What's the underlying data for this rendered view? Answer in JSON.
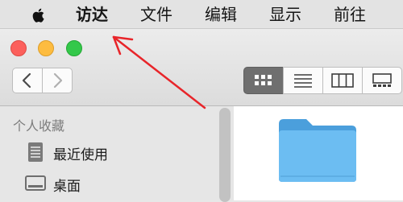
{
  "menubar": {
    "apple_icon": "apple-logo-icon",
    "items": [
      {
        "label": "访达",
        "bold": true
      },
      {
        "label": "文件"
      },
      {
        "label": "编辑"
      },
      {
        "label": "显示"
      },
      {
        "label": "前往"
      }
    ]
  },
  "window": {
    "traffic_lights": {
      "close": "#fc605c",
      "minimize": "#fdbc40",
      "maximize": "#34c84a"
    },
    "toolbar": {
      "back_icon": "chevron-left-icon",
      "forward_icon": "chevron-right-icon",
      "view_modes": [
        "icon-view",
        "list-view",
        "column-view",
        "gallery-view"
      ],
      "selected_view": "icon-view"
    },
    "sidebar": {
      "heading": "个人收藏",
      "items": [
        {
          "label": "最近使用",
          "icon": "recents-icon"
        },
        {
          "label": "桌面",
          "icon": "desktop-icon"
        }
      ]
    },
    "content": {
      "items": [
        {
          "icon": "folder-icon",
          "color": "#5aaee8"
        }
      ]
    }
  },
  "annotation": {
    "arrow_color": "#e8252a"
  }
}
